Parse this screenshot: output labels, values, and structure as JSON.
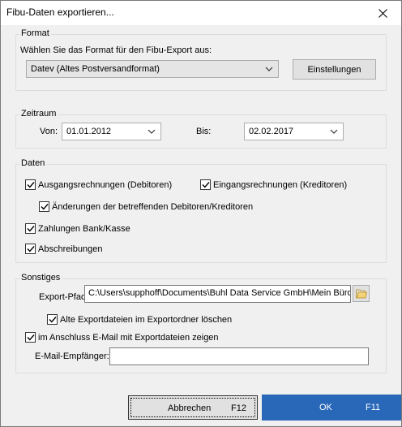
{
  "window": {
    "title": "Fibu-Daten exportieren..."
  },
  "format": {
    "legend": "Format",
    "instruction": "Wählen Sie das Format für den Fibu-Export aus:",
    "selected": "Datev (Altes Postversandformat)",
    "settings_label": "Einstellungen"
  },
  "zeitraum": {
    "legend": "Zeitraum",
    "von_label": "Von:",
    "von_value": "01.01.2012",
    "bis_label": "Bis:",
    "bis_value": "02.02.2017"
  },
  "daten": {
    "legend": "Daten",
    "ausgang_label": "Ausgangsrechnungen (Debitoren)",
    "ausgang_checked": true,
    "eingang_label": "Eingangsrechnungen (Kreditoren)",
    "eingang_checked": true,
    "aenderungen_label": "Änderungen der betreffenden Debitoren/Kreditoren",
    "aenderungen_checked": true,
    "zahlungen_label": "Zahlungen Bank/Kasse",
    "zahlungen_checked": true,
    "abschreibungen_label": "Abschreibungen",
    "abschreibungen_checked": true
  },
  "sonstiges": {
    "legend": "Sonstiges",
    "export_pfad_label": "Export-Pfad:",
    "export_pfad_value": "C:\\Users\\supphoff\\Documents\\Buhl Data Service GmbH\\Mein Büro\\",
    "alte_label": "Alte Exportdateien im Exportordner löschen",
    "alte_checked": true,
    "email_label": "im Anschluss E-Mail mit Exportdateien zeigen",
    "email_checked": true,
    "empfaenger_label": "E-Mail-Empfänger:",
    "empfaenger_value": ""
  },
  "footer": {
    "cancel_label": "Abbrechen",
    "cancel_key": "F12",
    "ok_label": "OK",
    "ok_key": "F11"
  },
  "colors": {
    "ok_button": "#2968b8",
    "window_bg": "#f0f0f0"
  }
}
